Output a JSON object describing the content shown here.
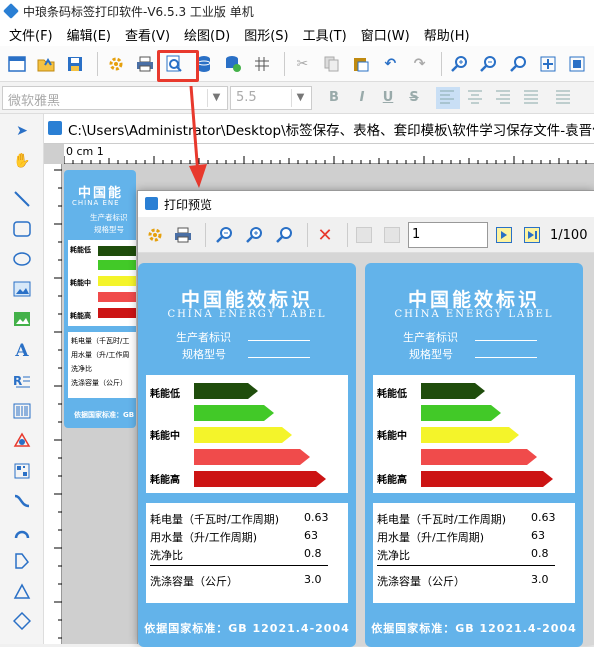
{
  "window": {
    "title": "中琅条码标签打印软件-V6.5.3 工业版 单机"
  },
  "menu": [
    "文件(F)",
    "编辑(E)",
    "查看(V)",
    "绘图(D)",
    "图形(S)",
    "工具(T)",
    "窗口(W)",
    "帮助(H)"
  ],
  "toolbar": {
    "font_name": "微软雅黑",
    "font_size": "5.5",
    "bold": "B",
    "italic": "I",
    "underline": "U",
    "strike": "S"
  },
  "document": {
    "tab_path": "C:\\Users\\Administrator\\Desktop\\标签保存、表格、套印模板\\软件学习保存文件-袁晋佳",
    "ruler_start": "0 cm 1"
  },
  "background_label": {
    "title": "中国能",
    "sub": "CHINA ENE",
    "f1": "生产者标识",
    "f2": "规格型号",
    "g1": "耗能低",
    "g2": "耗能中",
    "g3": "耗能高",
    "d1": "耗电量（千瓦时/工",
    "d2": "用水量（升/工作周",
    "d3": "洗净比",
    "d4": "洗涤容量（公斤）",
    "foot": "依据国家标准：GB"
  },
  "preview": {
    "title": "打印预览",
    "page_input": "1",
    "page_count": "1/100"
  },
  "label": {
    "title": "中国能效标识",
    "subtitle": "CHINA ENERGY LABEL",
    "field_producer": "生产者标识",
    "field_model": "规格型号",
    "grade_low": "耗能低",
    "grade_mid": "耗能中",
    "grade_high": "耗能高",
    "row1_label": "耗电量（千瓦时/工作周期)",
    "row1_value": "0.63",
    "row2_label": "用水量（升/工作周期)",
    "row2_value": "63",
    "row3_label": "洗净比",
    "row3_value": "0.8",
    "row4_label": "洗涤容量（公斤）",
    "row4_value": "3.0",
    "footer": "依据国家标准：GB 12021.4-2004"
  },
  "colors": {
    "label_bg": "#63b3ea",
    "bar1": "#1f4d0c",
    "bar2": "#42c928",
    "bar3": "#f4f42a",
    "bar4": "#f04b4b",
    "bar5": "#cc1414",
    "highlight": "#e8392d"
  }
}
